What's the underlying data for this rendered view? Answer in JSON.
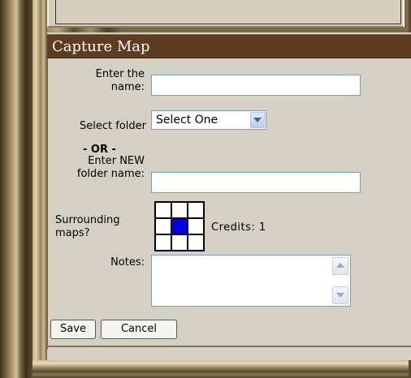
{
  "panel": {
    "title": "Capture Map"
  },
  "form": {
    "name_label_line1": "Enter the",
    "name_label_line2": "name:",
    "name_value": "",
    "folder_label": "Select folder",
    "folder_selected": "Select One",
    "or_text": "- OR -",
    "new_folder_label_line1": "Enter NEW",
    "new_folder_label_line2": "folder name:",
    "new_folder_value": "",
    "surrounding_label_line1": "Surrounding",
    "surrounding_label_line2": "maps?",
    "credits_text": "Credits: 1",
    "notes_label": "Notes:",
    "notes_value": ""
  },
  "buttons": {
    "save": "Save",
    "cancel": "Cancel"
  },
  "colors": {
    "header_bg": "#5c3d22",
    "selected_cell": "#0000e6"
  },
  "icons": {
    "select_arrow": "chevron-down-icon",
    "scroll_up": "scroll-up-icon",
    "scroll_down": "scroll-down-icon"
  }
}
